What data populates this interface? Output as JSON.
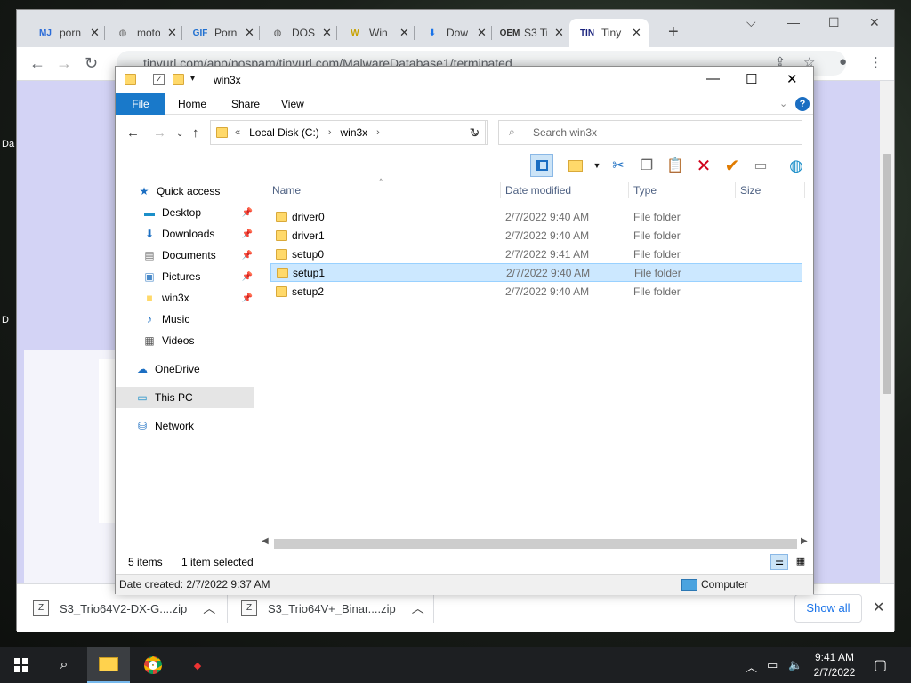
{
  "desktop": {
    "frag1": "Da",
    "frag2": "D"
  },
  "browser": {
    "tabs": [
      {
        "title": "porn",
        "icon": "MJ",
        "color": "#2a6bd8"
      },
      {
        "title": "moto",
        "icon": "globe",
        "color": "#666666"
      },
      {
        "title": "Porn",
        "icon": "GIF",
        "color": "#1f6fd0"
      },
      {
        "title": "DOS",
        "icon": "globe",
        "color": "#555555"
      },
      {
        "title": "Win",
        "icon": "W",
        "color": "#c8a200"
      },
      {
        "title": "Dow",
        "icon": "download",
        "color": "#1a73e8"
      },
      {
        "title": "S3 Ti",
        "icon": "OEM",
        "color": "#333333"
      },
      {
        "title": "Tiny",
        "icon": "TINY URL",
        "color": "#1a237e"
      }
    ],
    "url": "tinyurl.com/app/nospam/tinyurl.com/MalwareDatabase1/terminated",
    "downloads": [
      {
        "name": "S3_Trio64V2-DX-G....zip"
      },
      {
        "name": "S3_Trio64V+_Binar....zip"
      }
    ],
    "show_all": "Show all"
  },
  "explorer": {
    "title": "win3x",
    "ribbon_tabs": [
      "File",
      "Home",
      "Share",
      "View"
    ],
    "breadcrumb": [
      "Local Disk (C:)",
      "win3x"
    ],
    "search_placeholder": "Search win3x",
    "nav": [
      {
        "label": "Quick access",
        "icon": "star-icon",
        "pinned": false
      },
      {
        "label": "Desktop",
        "icon": "desktop-icon",
        "pinned": true
      },
      {
        "label": "Downloads",
        "icon": "download-icon",
        "pinned": true
      },
      {
        "label": "Documents",
        "icon": "document-icon",
        "pinned": true
      },
      {
        "label": "Pictures",
        "icon": "picture-icon",
        "pinned": true
      },
      {
        "label": "win3x",
        "icon": "folder-icon",
        "pinned": true
      },
      {
        "label": "Music",
        "icon": "music-icon",
        "pinned": false
      },
      {
        "label": "Videos",
        "icon": "video-icon",
        "pinned": false
      },
      {
        "label": "OneDrive",
        "icon": "cloud-icon",
        "pinned": false
      },
      {
        "label": "This PC",
        "icon": "computer-icon",
        "pinned": false,
        "selected": true
      },
      {
        "label": "Network",
        "icon": "network-icon",
        "pinned": false
      }
    ],
    "columns": [
      "Name",
      "Date modified",
      "Type",
      "Size"
    ],
    "files": [
      {
        "name": "driver0",
        "date": "2/7/2022 9:40 AM",
        "type": "File folder",
        "size": ""
      },
      {
        "name": "driver1",
        "date": "2/7/2022 9:40 AM",
        "type": "File folder",
        "size": ""
      },
      {
        "name": "setup0",
        "date": "2/7/2022 9:41 AM",
        "type": "File folder",
        "size": ""
      },
      {
        "name": "setup1",
        "date": "2/7/2022 9:40 AM",
        "type": "File folder",
        "size": "",
        "selected": true
      },
      {
        "name": "setup2",
        "date": "2/7/2022 9:40 AM",
        "type": "File folder",
        "size": ""
      }
    ],
    "status_items": "5 items",
    "status_selected": "1 item selected",
    "details_created": "Date created: 2/7/2022 9:37 AM",
    "details_location": "Computer"
  },
  "taskbar": {
    "time": "9:41 AM",
    "date": "2/7/2022"
  },
  "colors": {
    "file_tab": "#1979ca",
    "selection": "#cce8ff",
    "page_bg": "#d3d3f5"
  }
}
